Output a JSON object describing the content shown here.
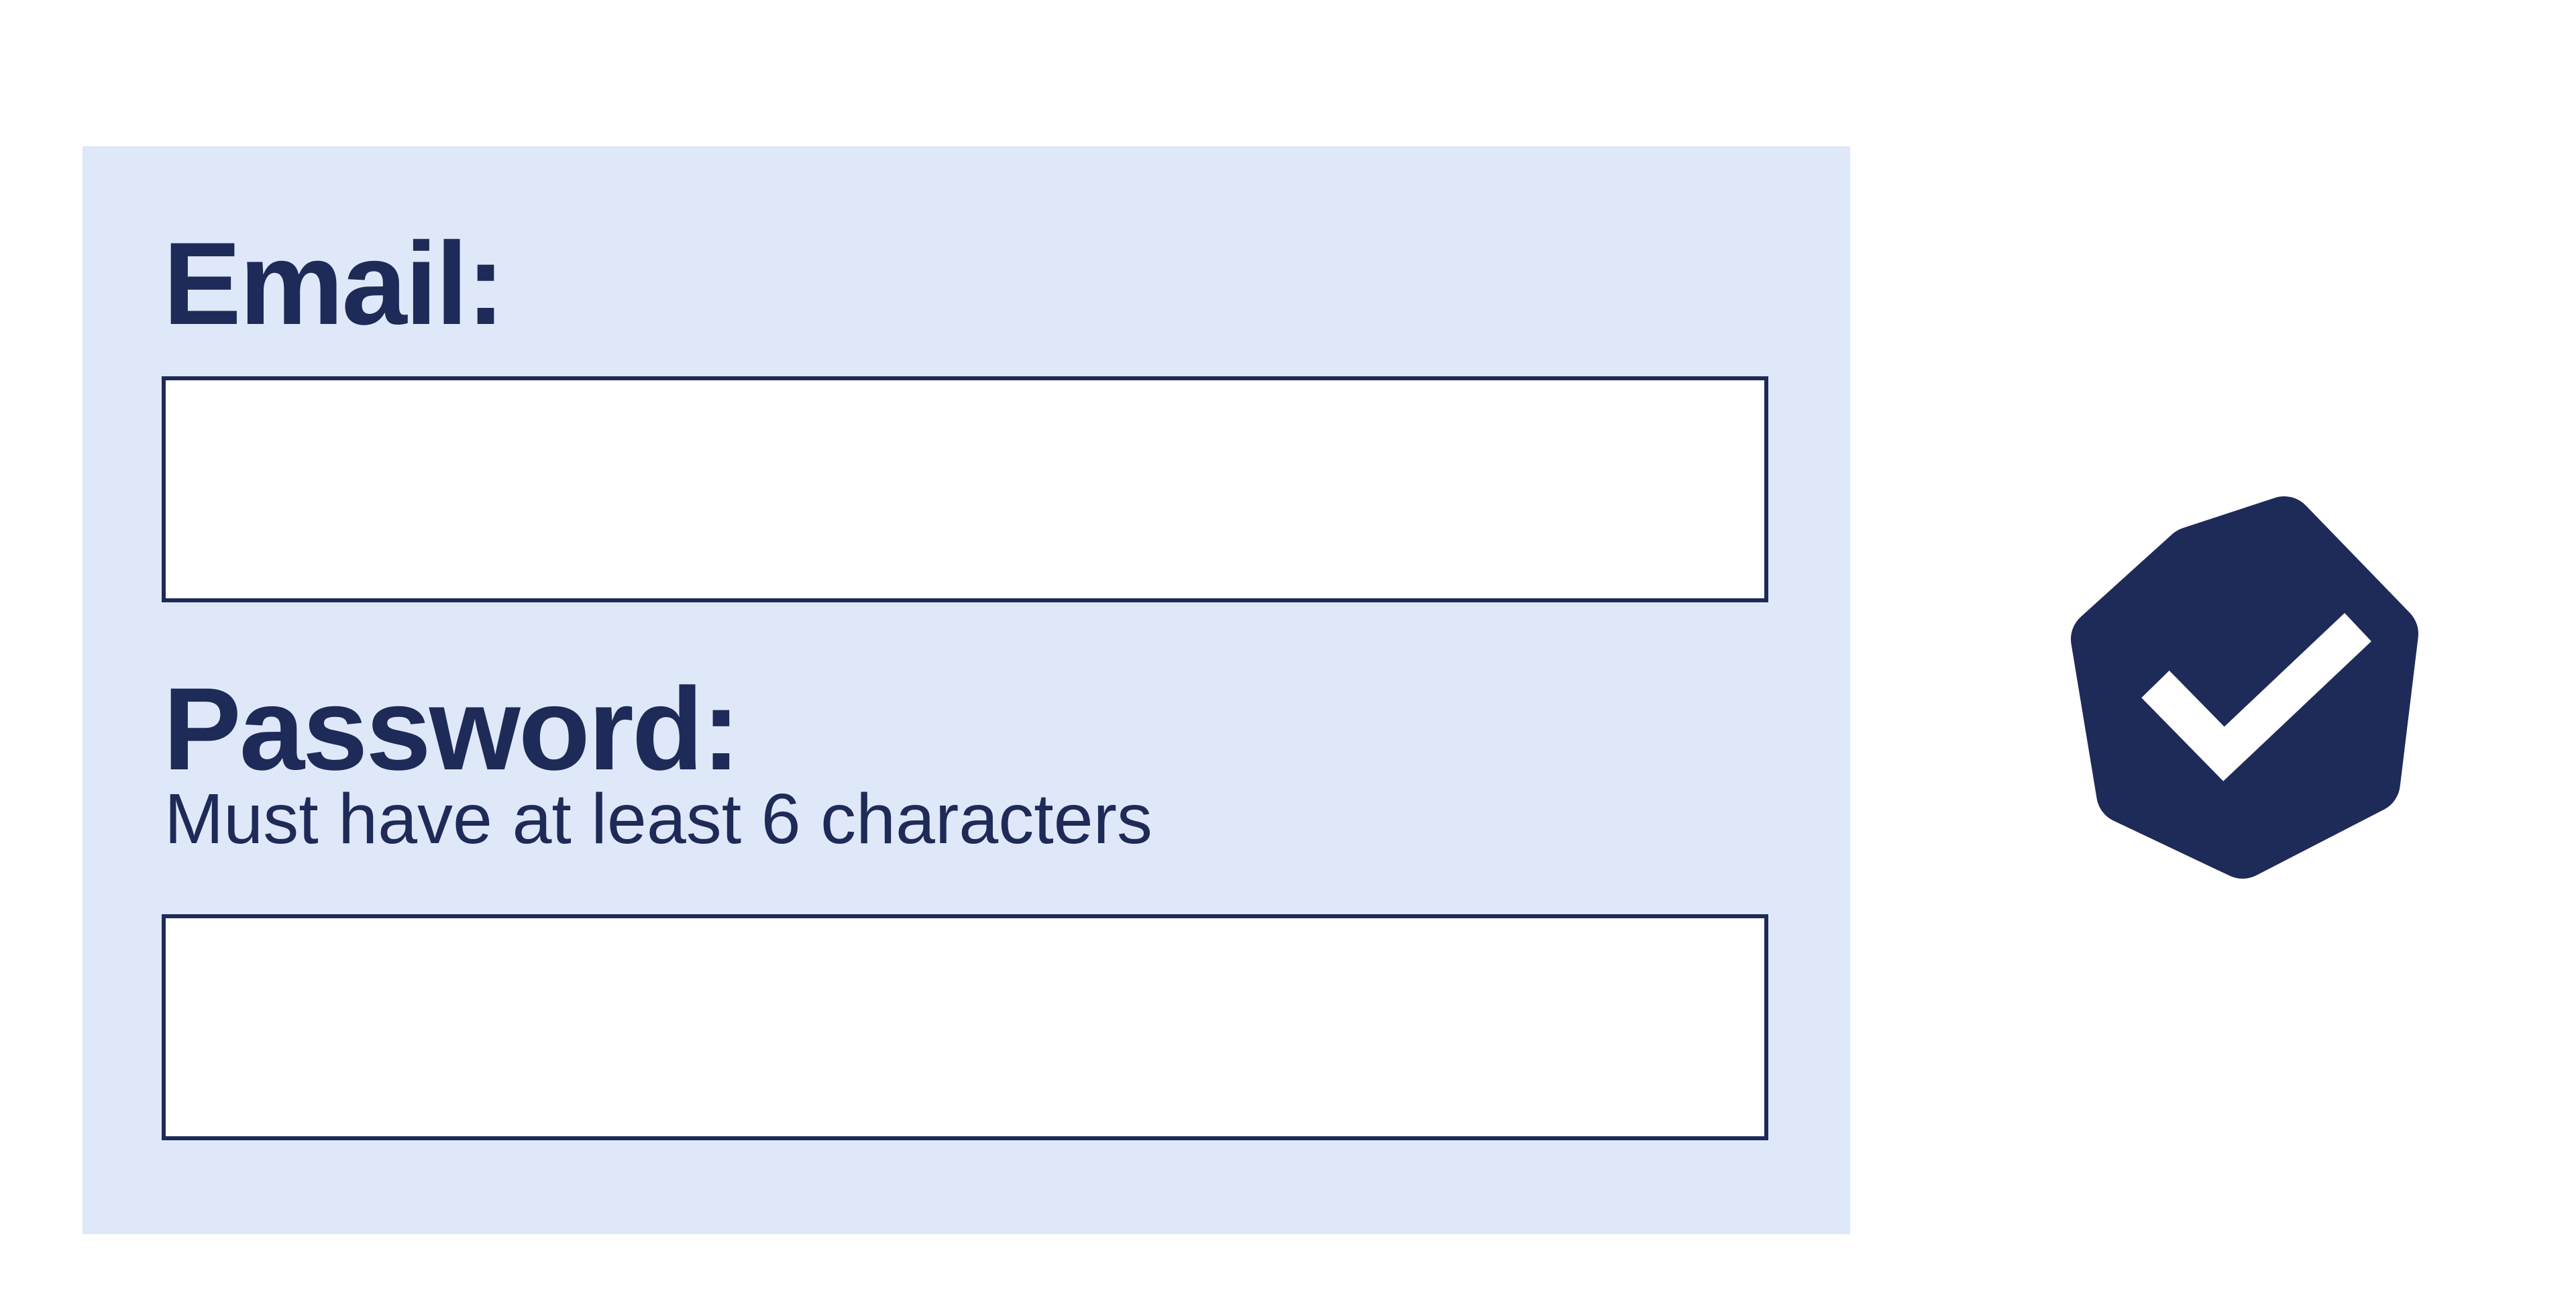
{
  "form": {
    "email": {
      "label": "Email:",
      "value": ""
    },
    "password": {
      "label": "Password:",
      "hint": "Must have at least 6 characters",
      "value": ""
    }
  },
  "badge": {
    "icon": "check-badge-icon",
    "color": "#1e2a57",
    "check_color": "#ffffff",
    "state": "valid"
  },
  "colors": {
    "panel_background": "#dfe8f9",
    "text": "#1e2a57",
    "input_border": "#1e2a57",
    "input_background": "#ffffff"
  }
}
